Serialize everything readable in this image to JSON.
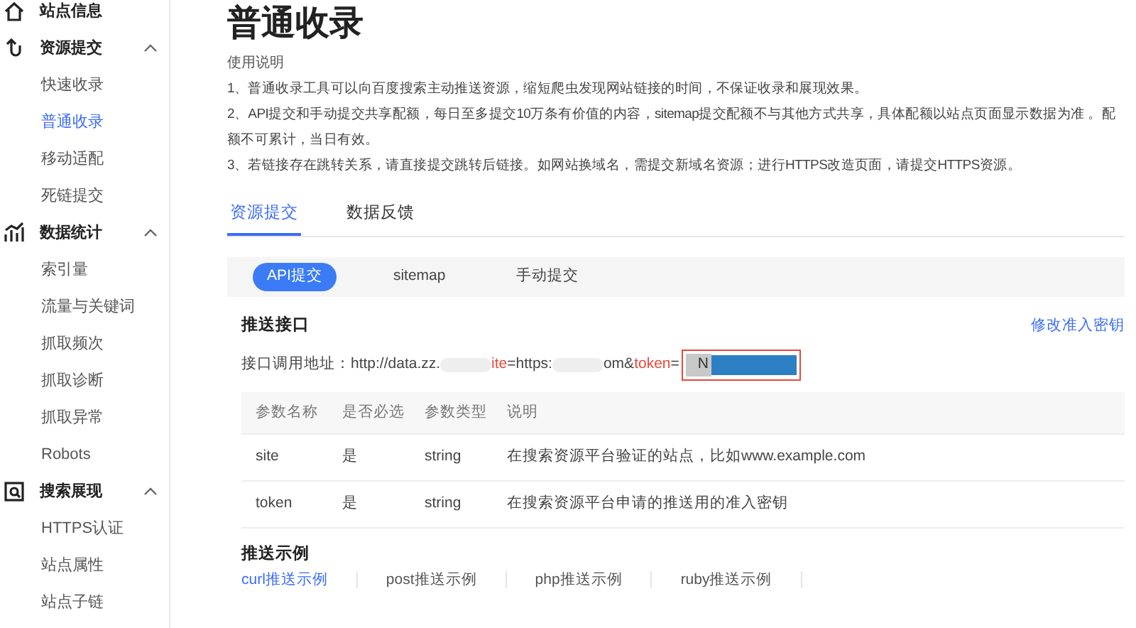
{
  "sidebar": {
    "groups": [
      {
        "label": "站点信息"
      },
      {
        "label": "资源提交",
        "expanded": true,
        "items": [
          {
            "label": "快速收录",
            "selected": false
          },
          {
            "label": "普通收录",
            "selected": true
          },
          {
            "label": "移动适配",
            "selected": false
          },
          {
            "label": "死链提交",
            "selected": false
          }
        ]
      },
      {
        "label": "数据统计",
        "expanded": true,
        "items": [
          {
            "label": "索引量",
            "selected": false
          },
          {
            "label": "流量与关键词",
            "selected": false
          },
          {
            "label": "抓取频次",
            "selected": false
          },
          {
            "label": "抓取诊断",
            "selected": false
          },
          {
            "label": "抓取异常",
            "selected": false
          },
          {
            "label": "Robots",
            "selected": false
          }
        ]
      },
      {
        "label": "搜索展现",
        "expanded": true,
        "items": [
          {
            "label": "HTTPS认证",
            "selected": false
          },
          {
            "label": "站点属性",
            "selected": false
          },
          {
            "label": "站点子链",
            "selected": false
          }
        ]
      }
    ]
  },
  "title": "普通收录",
  "instructions": {
    "heading": "使用说明",
    "lines": [
      "1、普通收录工具可以向百度搜索主动推送资源，缩短爬虫发现网站链接的时间，不保证收录和展现效果。",
      "2、API提交和手动提交共享配额，每日至多提交10万条有价值的内容，sitemap提交配额不与其他方式共享，具体配额以站点页面显示数据为准 。配额不可累计，当日有效。",
      "3、若链接存在跳转关系，请直接提交跳转后链接。如网站换域名，需提交新域名资源；进行HTTPS改造页面，请提交HTTPS资源。"
    ]
  },
  "tabs": [
    {
      "label": "资源提交",
      "selected": true
    },
    {
      "label": "数据反馈",
      "selected": false
    }
  ],
  "subtabs": [
    {
      "label": "API提交",
      "selected": true
    },
    {
      "label": "sitemap",
      "selected": false
    },
    {
      "label": "手动提交",
      "selected": false
    }
  ],
  "push_api": {
    "heading": "推送接口",
    "link": "修改准入密钥",
    "url_label": "接口调用地址：",
    "url_parts": [
      {
        "kind": "text",
        "text": "http://data.zz."
      },
      {
        "kind": "blur"
      },
      {
        "kind": "param",
        "text": "ite"
      },
      {
        "kind": "text",
        "text": "=https:"
      },
      {
        "kind": "blur"
      },
      {
        "kind": "text",
        "text": "om&"
      },
      {
        "kind": "param",
        "text": "token"
      },
      {
        "kind": "text",
        "text": "="
      }
    ],
    "token_value": "N"
  },
  "table": {
    "columns": [
      "参数名称",
      "是否必选",
      "参数类型",
      "说明"
    ],
    "rows": [
      [
        "site",
        "是",
        "string",
        "在搜索资源平台验证的站点，比如www.example.com"
      ],
      [
        "token",
        "是",
        "string",
        "在搜索资源平台申请的推送用的准入密钥"
      ]
    ]
  },
  "examples": {
    "heading": "推送示例",
    "tabs": [
      {
        "label": "curl推送示例",
        "selected": true
      },
      {
        "label": "post推送示例",
        "selected": false
      },
      {
        "label": "php推送示例",
        "selected": false
      },
      {
        "label": "ruby推送示例",
        "selected": false
      }
    ]
  }
}
